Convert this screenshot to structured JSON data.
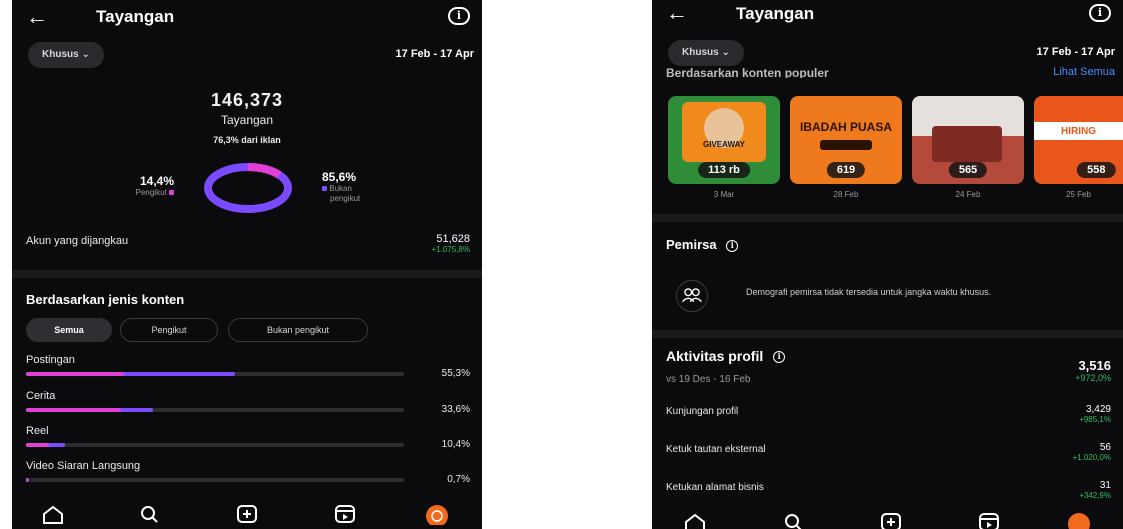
{
  "header": {
    "title": "Tayangan"
  },
  "filter": {
    "label": "Khusus",
    "date_range": "17 Feb - 17 Apr"
  },
  "left": {
    "total": "146,373",
    "total_label": "Tayangan",
    "ads_line": "76,3% dari iklan",
    "followers_pct": "14,4%",
    "followers_label": "Pengikut",
    "nonfollowers_pct": "85,6%",
    "nonfollowers_label_1": "Bukan",
    "nonfollowers_label_2": "pengikut",
    "donut": {
      "followers_fraction": 0.144,
      "nonfollowers_fraction": 0.856
    },
    "reach_label": "Akun yang dijangkau",
    "reach_value": "51,628",
    "reach_delta": "+1.075,8%",
    "content_heading": "Berdasarkan jenis konten",
    "tabs": [
      "Semua",
      "Pengikut",
      "Bukan pengikut"
    ],
    "bars": [
      {
        "label": "Postingan",
        "pct": "55,3%",
        "total": 0.553,
        "followers": 0.26
      },
      {
        "label": "Cerita",
        "pct": "33,6%",
        "total": 0.336,
        "followers": 0.25
      },
      {
        "label": "Reel",
        "pct": "10,4%",
        "total": 0.104,
        "followers": 0.06
      },
      {
        "label": "Video Siaran Langsung",
        "pct": "0,7%",
        "total": 0.007,
        "followers": 0.004
      }
    ]
  },
  "right": {
    "top_content_heading": "Berdasarkan konten populer",
    "see_all": "Lihat Semua",
    "thumbs": [
      {
        "count": "113 rb",
        "date": "3 Mar",
        "text": "GIVEAWAY"
      },
      {
        "count": "619",
        "date": "28 Feb",
        "text": "IBADAH PUASA"
      },
      {
        "count": "565",
        "date": "24 Feb",
        "text": ""
      },
      {
        "count": "558",
        "date": "25 Feb",
        "text": "HIRING"
      }
    ],
    "audience_heading": "Pemirsa",
    "audience_note": "Demografi pemirsa tidak tersedia untuk jangka waktu khusus.",
    "profile_heading": "Aktivitas profil",
    "profile_value": "3,516",
    "profile_compare": "vs 19 Des - 16 Feb",
    "profile_delta": "+972,0%",
    "metrics": [
      {
        "label": "Kunjungan profil",
        "value": "3,429",
        "delta": "+985,1%"
      },
      {
        "label": "Ketuk tautan eksternal",
        "value": "56",
        "delta": "+1.020,0%"
      },
      {
        "label": "Ketukan alamat bisnis",
        "value": "31",
        "delta": "+342,9%"
      }
    ]
  },
  "colors": {
    "followers": "#e23fd6",
    "nonfollowers": "#7a4bff",
    "positive": "#2fbf5a",
    "profile_orange": "#f26b1d"
  },
  "nav_icons": [
    "home-icon",
    "search-icon",
    "add-post-icon",
    "reels-icon",
    "profile-avatar"
  ]
}
